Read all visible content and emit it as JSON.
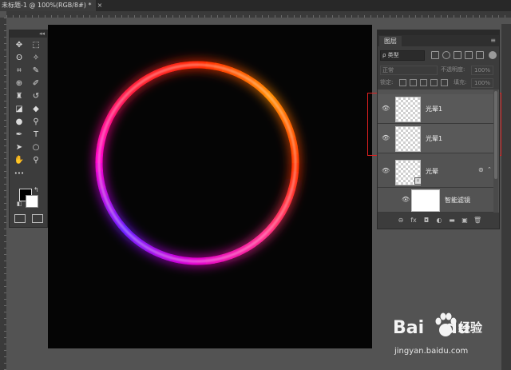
{
  "document": {
    "tab_title": "未标题-1 @ 100%(RGB/8#) *",
    "close_glyph": "×"
  },
  "tools_panel": {
    "collapse_glyph": "◂◂",
    "tools": [
      {
        "name": "move-tool-icon",
        "glyph": "✥"
      },
      {
        "name": "marquee-tool-icon",
        "glyph": "⬚"
      },
      {
        "name": "lasso-tool-icon",
        "glyph": "ʘ"
      },
      {
        "name": "magic-wand-icon",
        "glyph": "✧"
      },
      {
        "name": "crop-tool-icon",
        "glyph": "⌗"
      },
      {
        "name": "eyedropper-icon",
        "glyph": "✎"
      },
      {
        "name": "healing-brush-icon",
        "glyph": "⊕"
      },
      {
        "name": "brush-tool-icon",
        "glyph": "✐"
      },
      {
        "name": "stamp-tool-icon",
        "glyph": "♜"
      },
      {
        "name": "history-brush-icon",
        "glyph": "↺"
      },
      {
        "name": "eraser-icon",
        "glyph": "◪"
      },
      {
        "name": "paint-bucket-icon",
        "glyph": "◆"
      },
      {
        "name": "blur-tool-icon",
        "glyph": "●"
      },
      {
        "name": "dodge-tool-icon",
        "glyph": "⚲"
      },
      {
        "name": "pen-tool-icon",
        "glyph": "✒"
      },
      {
        "name": "type-tool-icon",
        "glyph": "T"
      },
      {
        "name": "path-select-icon",
        "glyph": "➤"
      },
      {
        "name": "ellipse-tool-icon",
        "glyph": "○"
      },
      {
        "name": "hand-tool-icon",
        "glyph": "✋"
      },
      {
        "name": "zoom-tool-icon",
        "glyph": "⚲"
      },
      {
        "name": "more-tools-icon",
        "glyph": "•••"
      }
    ],
    "swap_glyph": "↰",
    "default_glyph": "◧"
  },
  "layers_panel": {
    "tab_label": "图层",
    "menu_glyph": "≡",
    "collapse_glyph": "◂◂",
    "filter_label": "ρ 类型",
    "blend_mode": "正常",
    "opacity_label": "不透明度:",
    "opacity_value": "100%",
    "lock_label": "锁定:",
    "fill_label": "填充:",
    "fill_value": "100%",
    "layers": [
      {
        "name": "光晕1",
        "visible": true
      },
      {
        "name": "光晕1",
        "visible": true
      },
      {
        "name": "光晕",
        "visible": true,
        "smart_object": true
      },
      {
        "name": "智能滤镜",
        "visible": true,
        "filter_mask": true
      }
    ],
    "eye_glyph": "👁",
    "bottom_icons": [
      "link-icon",
      "fx-icon",
      "mask-icon",
      "adjustment-icon",
      "folder-icon",
      "new-layer-icon",
      "trash-icon"
    ],
    "bottom_glyphs": [
      "⊖",
      "fx",
      "◘",
      "◐",
      "▬",
      "▣",
      "🗑"
    ]
  },
  "canvas": {
    "background": "#050505",
    "ring_colors": [
      "#ff2a00",
      "#ff8a00",
      "#ff3300",
      "#ff2d8a",
      "#e000d0",
      "#6a1cff",
      "#ff00c8",
      "#ff1e3c"
    ]
  },
  "watermark": {
    "brand": "Bai",
    "brand_tail": "du",
    "product": "经验",
    "url": "jingyan.baidu.com"
  }
}
